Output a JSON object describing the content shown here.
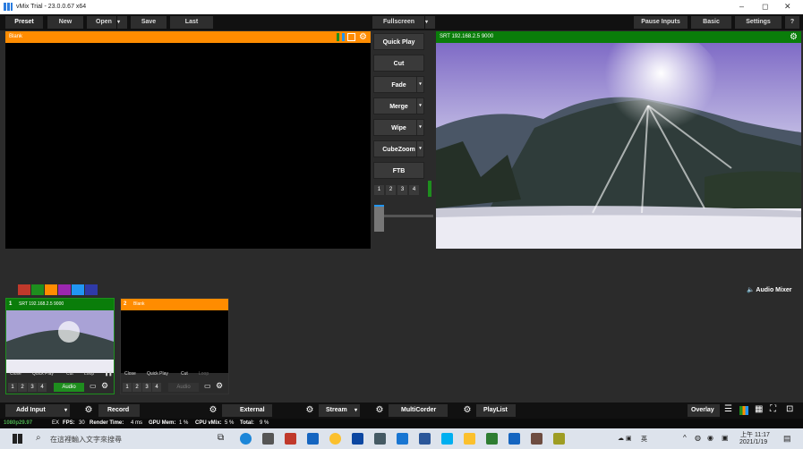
{
  "window": {
    "title": "vMix Trial - 23.0.0.67 x64",
    "min": "–",
    "max": "◻",
    "close": "✕"
  },
  "topbar": {
    "preset": "Preset",
    "new": "New",
    "open": "Open",
    "save": "Save",
    "last": "Last",
    "fullscreen": "Fullscreen",
    "pause_inputs": "Pause Inputs",
    "basic": "Basic",
    "settings": "Settings",
    "help": "?"
  },
  "preview": {
    "title": "Blank"
  },
  "output": {
    "title": "SRT 192.168.2.5 9000"
  },
  "transitions": {
    "quick_play": "Quick Play",
    "cut": "Cut",
    "fade": "Fade",
    "merge": "Merge",
    "wipe": "Wipe",
    "cubezoom": "CubeZoom",
    "ftb": "FTB",
    "nums": [
      "1",
      "2",
      "3",
      "4"
    ]
  },
  "audio_mixer": {
    "label": "Audio Mixer",
    "icon": "speaker-icon"
  },
  "color_swatches": [
    "#c0392b",
    "#1e8e1e",
    "#ff8c00",
    "#9b27b0",
    "#2196f3",
    "#2f3aa8"
  ],
  "inputs": [
    {
      "number": "1",
      "title": "SRT 192.168.2.5 9000",
      "header_color": "#0a7d0a",
      "controls": [
        "Close",
        "Quick Play",
        "Cut",
        "Loop"
      ],
      "nums": [
        "1",
        "2",
        "3",
        "4"
      ],
      "audio": "Audio"
    },
    {
      "number": "2",
      "title": "Blank",
      "header_color": "#ff8c00",
      "controls": [
        "Close",
        "Quick Play",
        "Cut",
        "Loop"
      ],
      "nums": [
        "1",
        "2",
        "3",
        "4"
      ],
      "audio": "Audio"
    }
  ],
  "bottombar": {
    "add_input": "Add Input",
    "record": "Record",
    "external": "External",
    "stream": "Stream",
    "multicorder": "MultiCorder",
    "playlist": "PlayList",
    "overlay": "Overlay"
  },
  "status": {
    "resolution": "1080p29.97",
    "ex": "EX",
    "fps_label": "FPS:",
    "fps": "30",
    "render_label": "Render Time:",
    "render": "4 ms",
    "gpu_label": "GPU Mem:",
    "gpu": "1 %",
    "cpu_label": "CPU vMix:",
    "cpu": "5 %",
    "total_label": "Total:",
    "total": "9 %"
  },
  "taskbar": {
    "search_placeholder": "在這裡輸入文字來搜尋",
    "time": "上午 11:17",
    "date": "2021/1/19",
    "lang": "英"
  }
}
